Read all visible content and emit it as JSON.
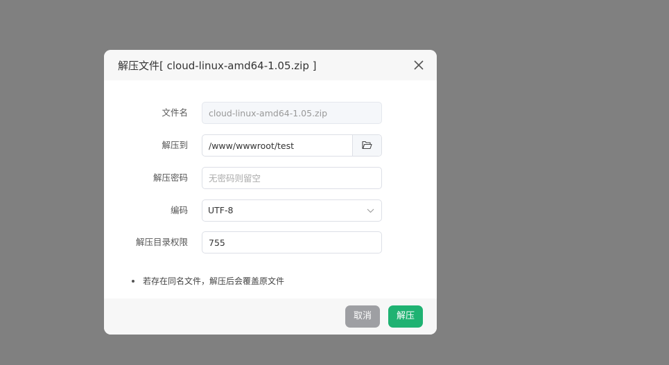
{
  "dialog": {
    "title": "解压文件[ cloud-linux-amd64-1.05.zip ]"
  },
  "form": {
    "filename": {
      "label": "文件名",
      "value": "cloud-linux-amd64-1.05.zip"
    },
    "extract_to": {
      "label": "解压到",
      "value": "/www/wwwroot/test"
    },
    "password": {
      "label": "解压密码",
      "placeholder": "无密码则留空"
    },
    "encoding": {
      "label": "编码",
      "selected": "UTF-8"
    },
    "permission": {
      "label": "解压目录权限",
      "value": "755"
    }
  },
  "notice": "若存在同名文件，解压后会覆盖原文件",
  "footer": {
    "cancel_label": "取消",
    "extract_label": "解压"
  },
  "colors": {
    "primary": "#1fb272",
    "cancel": "#9e9fa3",
    "overlay": "#808080"
  },
  "icons": {
    "close": "close-icon",
    "folder": "folder-icon",
    "dropdown": "chevron-down-icon"
  }
}
